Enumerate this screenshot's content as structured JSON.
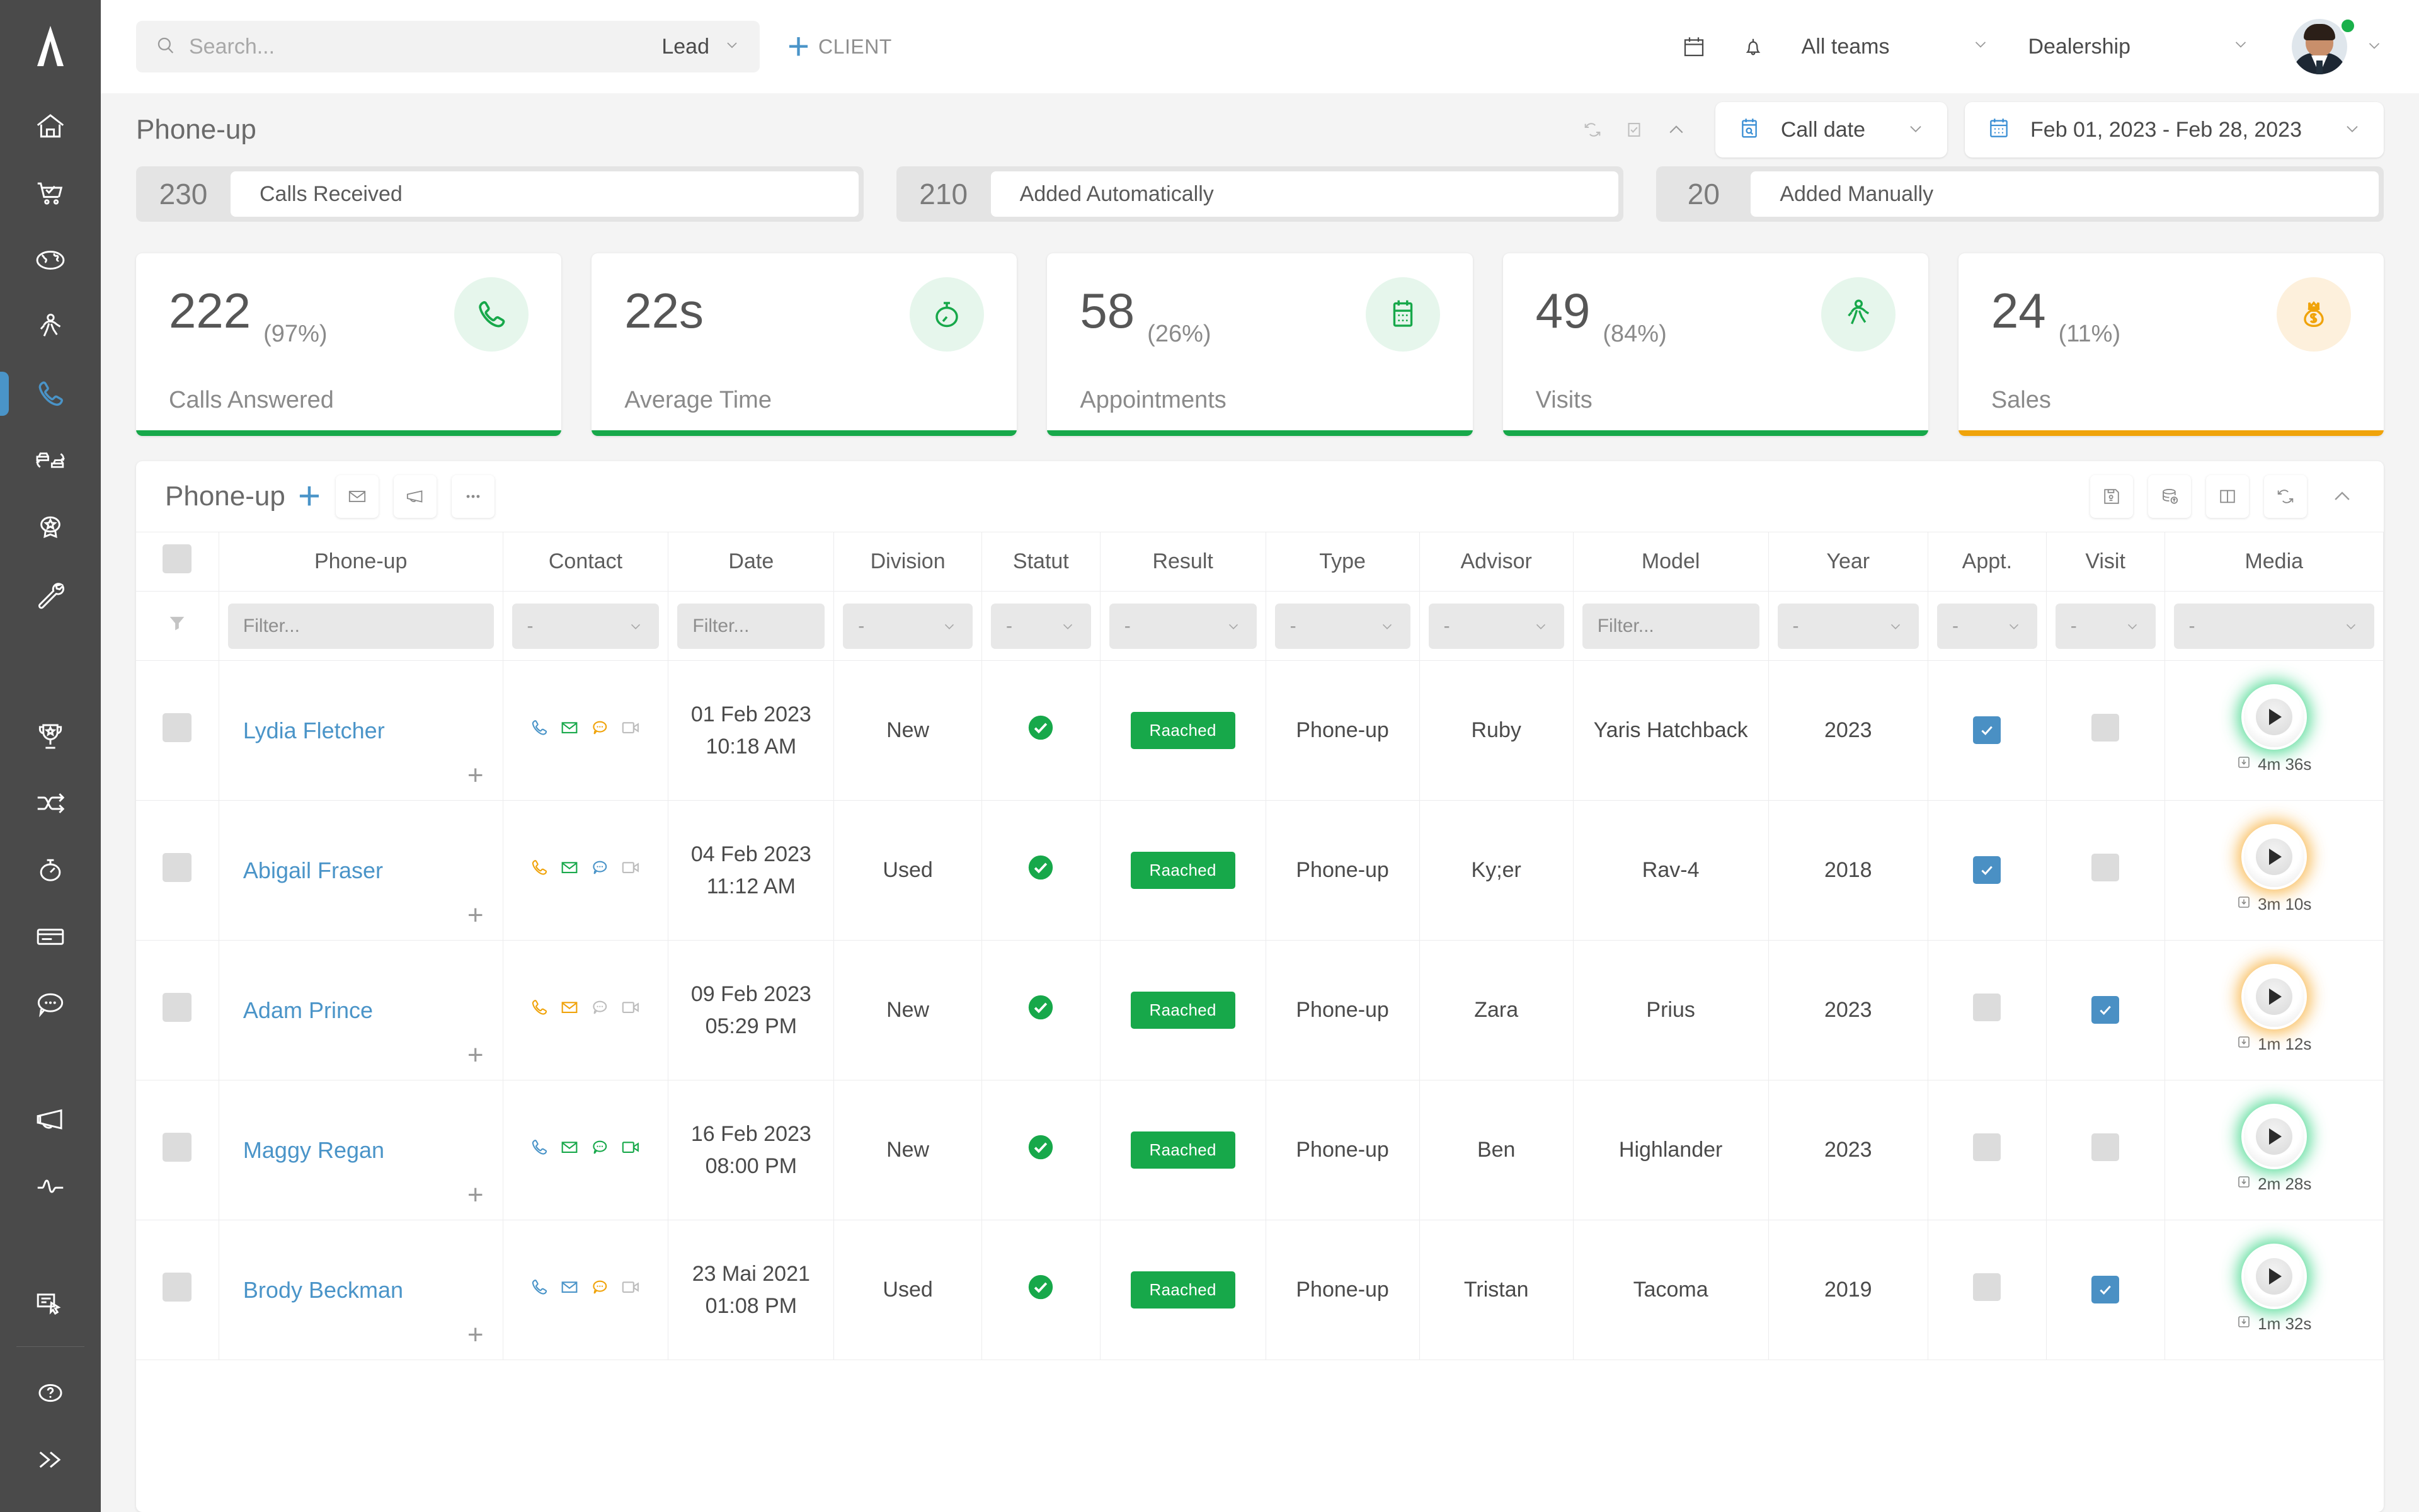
{
  "sidebar": {
    "logo": "brand-logo",
    "items": [
      {
        "icon": "home-icon",
        "name": "home",
        "active": false
      },
      {
        "icon": "cart-check-icon",
        "name": "sales",
        "active": false
      },
      {
        "icon": "globe-icon",
        "name": "web-leads",
        "active": false
      },
      {
        "icon": "walk-in-icon",
        "name": "walk-in",
        "active": false
      },
      {
        "icon": "phone-icon",
        "name": "phone-up",
        "active": true
      },
      {
        "icon": "car-trade-icon",
        "name": "trade-in",
        "active": false
      },
      {
        "icon": "award-badge-icon",
        "name": "loyalty",
        "active": false
      },
      {
        "icon": "wrench-icon",
        "name": "service",
        "active": false
      },
      {
        "icon": "trophy-icon",
        "name": "objectives",
        "active": false
      },
      {
        "icon": "shuffle-icon",
        "name": "workflow",
        "active": false
      },
      {
        "icon": "stopwatch-icon",
        "name": "performance",
        "active": false
      },
      {
        "icon": "card-icon",
        "name": "billing",
        "active": false
      },
      {
        "icon": "chat-bubble-icon",
        "name": "messages",
        "active": false
      },
      {
        "icon": "megaphone-icon",
        "name": "campaigns",
        "active": false
      },
      {
        "icon": "pulse-icon",
        "name": "analytics",
        "active": false
      },
      {
        "icon": "form-click-icon",
        "name": "forms",
        "active": false
      }
    ],
    "bottom": [
      {
        "icon": "help-circle-icon",
        "name": "help"
      },
      {
        "icon": "expand-chevrons-icon",
        "name": "expand-sidebar"
      }
    ]
  },
  "topbar": {
    "search_placeholder": "Search...",
    "search_value": "",
    "search_scope": "Lead",
    "add_client_label": "CLIENT",
    "calendar_icon": "calendar-icon",
    "bell_icon": "bell-icon",
    "team_select": "All teams",
    "org_select": "Dealership",
    "avatar": "user-avatar"
  },
  "page": {
    "title": "Phone-up",
    "toolbar_icons": [
      "refresh-icon",
      "checkbox-task-icon",
      "collapse-chevron-icon"
    ],
    "date_type": {
      "label": "Call date",
      "icon": "calendar-search-icon"
    },
    "date_range": {
      "label": "Feb 01, 2023 - Feb 28, 2023",
      "icon": "calendar-range-icon"
    }
  },
  "summary": [
    {
      "value": "230",
      "label": "Calls Received"
    },
    {
      "value": "210",
      "label": "Added Automatically"
    },
    {
      "value": "20",
      "label": "Added Manually"
    }
  ],
  "kpis": [
    {
      "value": "222",
      "pct": "(97%)",
      "label": "Calls Answered",
      "icon": "phone-icon",
      "accent": "green"
    },
    {
      "value": "22s",
      "pct": "",
      "label": "Average Time",
      "icon": "stopwatch-icon",
      "accent": "green"
    },
    {
      "value": "58",
      "pct": "(26%)",
      "label": "Appointments",
      "icon": "calendar-icon",
      "accent": "green"
    },
    {
      "value": "49",
      "pct": "(84%)",
      "label": "Visits",
      "icon": "walking-icon",
      "accent": "green"
    },
    {
      "value": "24",
      "pct": "(11%)",
      "label": "Sales",
      "icon": "money-bag-icon",
      "accent": "orange"
    }
  ],
  "panel": {
    "title": "Phone-up",
    "add_icon": "plus-icon",
    "left_icons": [
      "envelope-icon",
      "megaphone-icon",
      "ellipsis-icon"
    ],
    "right_icons": [
      "save-icon",
      "database-export-icon",
      "columns-icon",
      "refresh-icon",
      "collapse-chevron-icon"
    ]
  },
  "table": {
    "columns": [
      "Phone-up",
      "Contact",
      "Date",
      "Division",
      "Statut",
      "Result",
      "Type",
      "Advisor",
      "Model",
      "Year",
      "Appt.",
      "Visit",
      "Media"
    ],
    "filter_icon": "funnel-icon",
    "filters": [
      {
        "type": "text",
        "placeholder": "Filter..."
      },
      {
        "type": "select",
        "value": "-"
      },
      {
        "type": "text",
        "placeholder": "Filter..."
      },
      {
        "type": "select",
        "value": "-"
      },
      {
        "type": "select",
        "value": "-"
      },
      {
        "type": "select",
        "value": "-"
      },
      {
        "type": "select",
        "value": "-"
      },
      {
        "type": "select",
        "value": "-"
      },
      {
        "type": "text",
        "placeholder": "Filter..."
      },
      {
        "type": "select",
        "value": "-"
      },
      {
        "type": "select",
        "value": "-"
      },
      {
        "type": "select",
        "value": "-"
      },
      {
        "type": "select",
        "value": "-"
      }
    ],
    "rows": [
      {
        "name": "Lydia Fletcher",
        "contact": {
          "phone": "#4a94c8",
          "mail": "#17a84a",
          "chat": "#f0a30a",
          "video": "#bdbdbd"
        },
        "date": "01 Feb 2023",
        "time": "10:18 AM",
        "division": "New",
        "statut": "check",
        "result": "Raached",
        "type": "Phone-up",
        "advisor": "Ruby",
        "model": "Yaris Hatchback",
        "year": "2023",
        "appt": true,
        "visit": false,
        "duration": "4m 36s",
        "glow": "green"
      },
      {
        "name": "Abigail Fraser",
        "contact": {
          "phone": "#f0a30a",
          "mail": "#17a84a",
          "chat": "#4a94c8",
          "video": "#bdbdbd"
        },
        "date": "04 Feb 2023",
        "time": "11:12 AM",
        "division": "Used",
        "statut": "check",
        "result": "Raached",
        "type": "Phone-up",
        "advisor": "Ky;er",
        "model": "Rav-4",
        "year": "2018",
        "appt": true,
        "visit": false,
        "duration": "3m 10s",
        "glow": "orange"
      },
      {
        "name": "Adam Prince",
        "contact": {
          "phone": "#f0a30a",
          "mail": "#f0a30a",
          "chat": "#bdbdbd",
          "video": "#bdbdbd"
        },
        "date": "09 Feb 2023",
        "time": "05:29 PM",
        "division": "New",
        "statut": "check",
        "result": "Raached",
        "type": "Phone-up",
        "advisor": "Zara",
        "model": "Prius",
        "year": "2023",
        "appt": false,
        "visit": true,
        "duration": "1m 12s",
        "glow": "orange"
      },
      {
        "name": "Maggy Regan",
        "contact": {
          "phone": "#4a94c8",
          "mail": "#17a84a",
          "chat": "#17a84a",
          "video": "#17a84a"
        },
        "date": "16 Feb 2023",
        "time": "08:00 PM",
        "division": "New",
        "statut": "check",
        "result": "Raached",
        "type": "Phone-up",
        "advisor": "Ben",
        "model": "Highlander",
        "year": "2023",
        "appt": false,
        "visit": false,
        "duration": "2m 28s",
        "glow": "green"
      },
      {
        "name": "Brody Beckman",
        "contact": {
          "phone": "#4a94c8",
          "mail": "#4a94c8",
          "chat": "#f0a30a",
          "video": "#bdbdbd"
        },
        "date": "23 Mai 2021",
        "time": "01:08 PM",
        "division": "Used",
        "statut": "check",
        "result": "Raached",
        "type": "Phone-up",
        "advisor": "Tristan",
        "model": "Tacoma",
        "year": "2019",
        "appt": false,
        "visit": true,
        "duration": "1m 32s",
        "glow": "green"
      }
    ]
  },
  "colors": {
    "accent_blue": "#4a94c8",
    "green": "#17a84a",
    "orange": "#f0a30a",
    "sidebar": "#4a4a4a"
  }
}
